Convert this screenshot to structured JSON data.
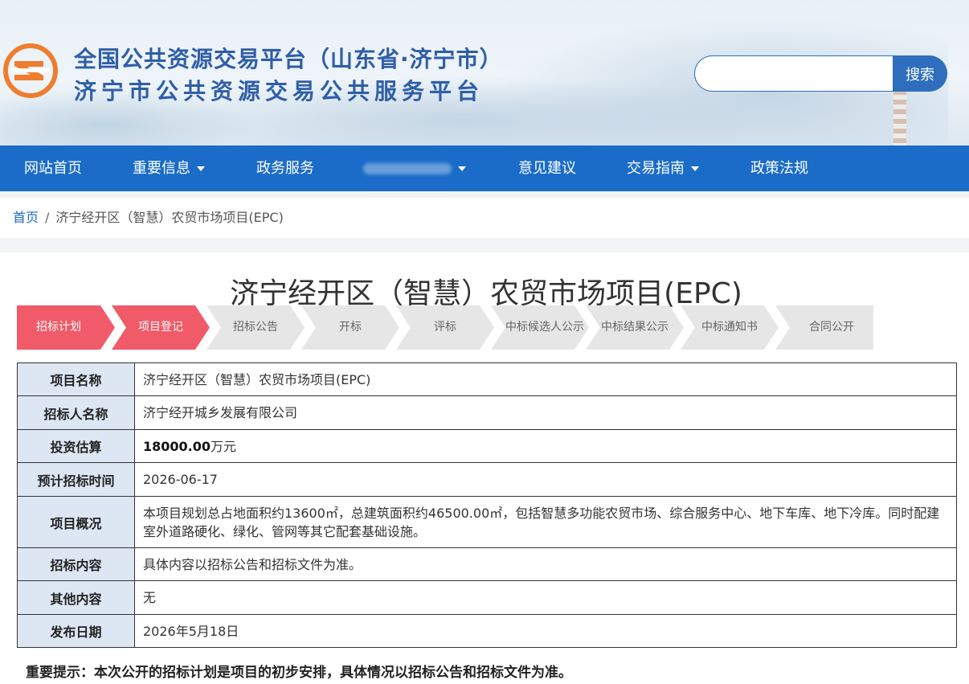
{
  "header": {
    "title_line1": "全国公共资源交易平台（山东省·济宁市）",
    "title_line2": "济宁市公共资源交易公共服务平台",
    "search_placeholder": "",
    "search_button": "搜索",
    "logo_icon": "ji-letter-logo-icon",
    "brand_color": "#2f5ea8"
  },
  "nav": {
    "items": [
      {
        "label": "网站首页",
        "dropdown": false
      },
      {
        "label": "重要信息",
        "dropdown": true
      },
      {
        "label": "政务服务",
        "dropdown": false
      },
      {
        "label": "",
        "dropdown": true
      },
      {
        "label": "意见建议",
        "dropdown": false
      },
      {
        "label": "交易指南",
        "dropdown": true
      },
      {
        "label": "政策法规",
        "dropdown": false
      }
    ],
    "background_color": "#1b6cc8"
  },
  "breadcrumb": {
    "home": "首页",
    "separator": "/",
    "current": "济宁经开区（智慧）农贸市场项目(EPC)"
  },
  "page_title": "济宁经开区（智慧）农贸市场项目(EPC)",
  "steps": {
    "items": [
      "招标计划",
      "项目登记",
      "招标公告",
      "开标",
      "评标",
      "中标候选人公示",
      "中标结果公示",
      "中标通知书",
      "合同公开"
    ],
    "active_count": 2,
    "active_color": "#f15a68",
    "inactive_color": "#e6e6e6"
  },
  "project": {
    "rows": [
      {
        "label": "项目名称",
        "value": "济宁经开区（智慧）农贸市场项目(EPC)"
      },
      {
        "label": "招标人名称",
        "value": "济宁经开城乡发展有限公司"
      },
      {
        "label": "投资估算",
        "value_number": "18000.00",
        "value_unit": "万元"
      },
      {
        "label": "预计招标时间",
        "value": "2026-06-17"
      },
      {
        "label": "项目概况",
        "value": "本项目规划总占地面积约13600㎡，总建筑面积约46500.00㎡，包括智慧多功能农贸市场、综合服务中心、地下车库、地下冷库。同时配建室外道路硬化、绿化、管网等其它配套基础设施。"
      },
      {
        "label": "招标内容",
        "value": "具体内容以招标公告和招标文件为准。"
      },
      {
        "label": "其他内容",
        "value": "无"
      },
      {
        "label": "发布日期",
        "value": "2026年5月18日"
      }
    ]
  },
  "notice": "重要提示：本次公开的招标计划是项目的初步安排，具体情况以招标公告和招标文件为准。"
}
